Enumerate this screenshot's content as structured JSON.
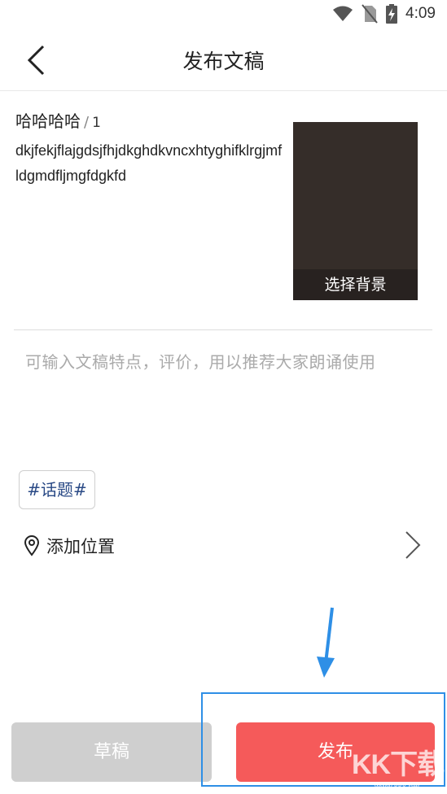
{
  "status_bar": {
    "time": "4:09"
  },
  "header": {
    "title": "发布文稿"
  },
  "draft": {
    "title": "哈哈哈哈",
    "separator": "/",
    "count": "1",
    "body": "dkjfekjflajgdsjfhjdkghdkvncxhtyghifklrgjmfldgmdfljmgfdgkfd"
  },
  "background": {
    "label": "选择背景"
  },
  "description": {
    "value": "",
    "placeholder": "可输入文稿特点，评价，用以推荐大家朗诵使用"
  },
  "topic": {
    "label": "#话题#"
  },
  "location": {
    "label": "添加位置"
  },
  "actions": {
    "draft_label": "草稿",
    "publish_label": "发布"
  },
  "watermark": {
    "text": "KK下载",
    "url": "www.kkx.net"
  },
  "colors": {
    "publish": "#f55a5a",
    "draft": "#cfcfcf",
    "topic_text": "#2a4a86",
    "annotation": "#2e8fe6"
  }
}
